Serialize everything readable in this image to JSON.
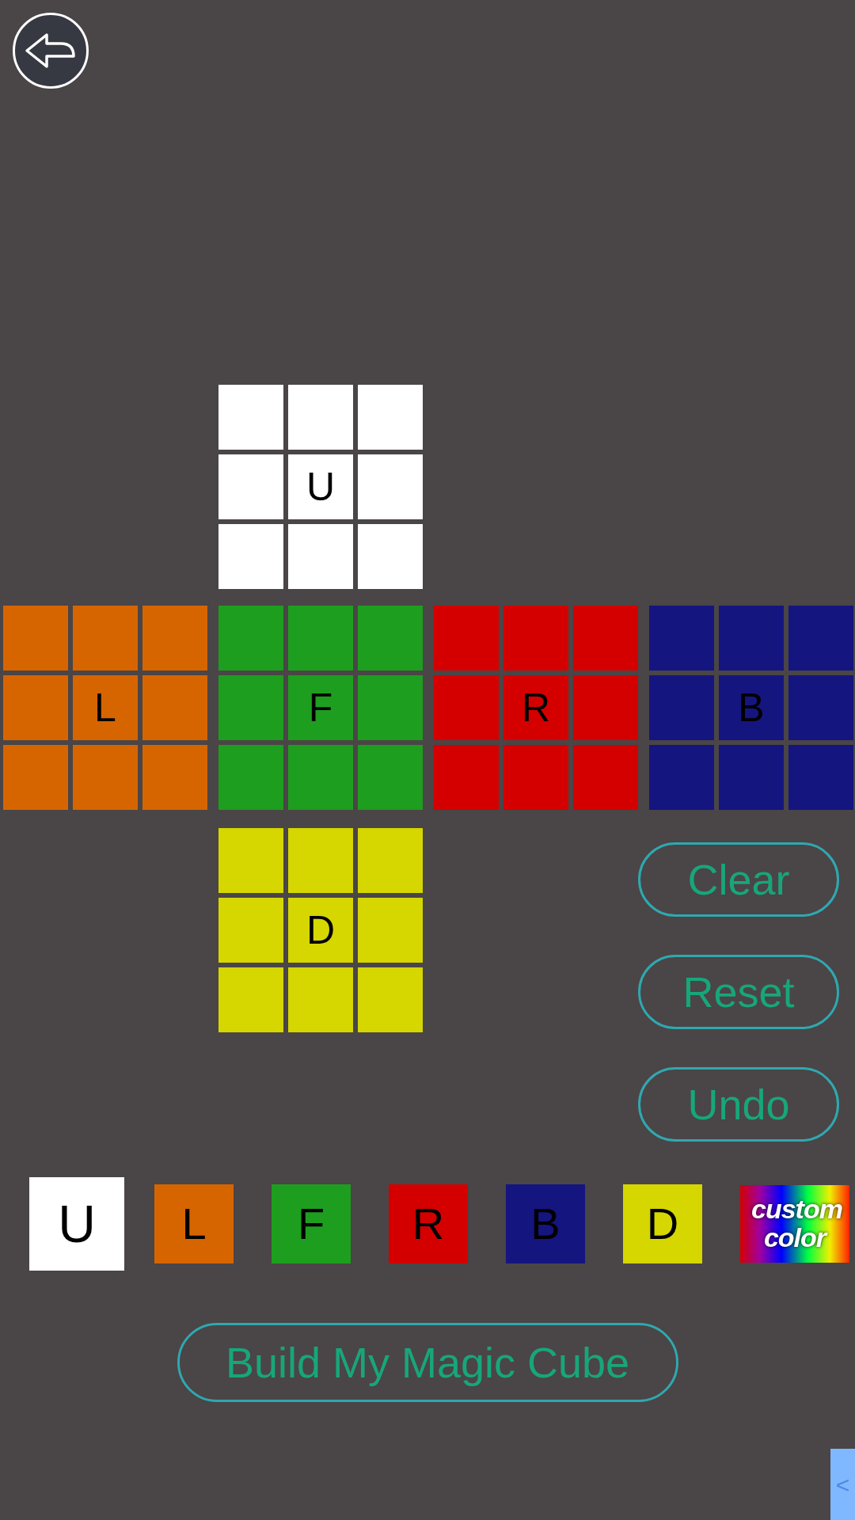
{
  "back_button": {
    "kind": "back"
  },
  "faces": [
    {
      "label": "U",
      "cells": [
        {
          "color": "#ffffff"
        },
        {
          "color": "#ffffff"
        },
        {
          "color": "#ffffff"
        },
        {
          "color": "#ffffff"
        },
        {
          "color": "#ffffff"
        },
        {
          "color": "#ffffff"
        },
        {
          "color": "#ffffff"
        },
        {
          "color": "#ffffff"
        },
        {
          "color": "#ffffff"
        }
      ]
    },
    {
      "label": "L",
      "cells": [
        {
          "color": "#d66500"
        },
        {
          "color": "#d66500"
        },
        {
          "color": "#d66500"
        },
        {
          "color": "#d66500"
        },
        {
          "color": "#d66500"
        },
        {
          "color": "#d66500"
        },
        {
          "color": "#d66500"
        },
        {
          "color": "#d66500"
        },
        {
          "color": "#d66500"
        }
      ]
    },
    {
      "label": "F",
      "cells": [
        {
          "color": "#1e9e1e"
        },
        {
          "color": "#1e9e1e"
        },
        {
          "color": "#1e9e1e"
        },
        {
          "color": "#1e9e1e"
        },
        {
          "color": "#1e9e1e"
        },
        {
          "color": "#1e9e1e"
        },
        {
          "color": "#1e9e1e"
        },
        {
          "color": "#1e9e1e"
        },
        {
          "color": "#1e9e1e"
        }
      ]
    },
    {
      "label": "R",
      "cells": [
        {
          "color": "#d40000"
        },
        {
          "color": "#d40000"
        },
        {
          "color": "#d40000"
        },
        {
          "color": "#d40000"
        },
        {
          "color": "#d40000"
        },
        {
          "color": "#d40000"
        },
        {
          "color": "#d40000"
        },
        {
          "color": "#d40000"
        },
        {
          "color": "#d40000"
        }
      ]
    },
    {
      "label": "B",
      "cells": [
        {
          "color": "#151580"
        },
        {
          "color": "#151580"
        },
        {
          "color": "#151580"
        },
        {
          "color": "#151580"
        },
        {
          "color": "#151580"
        },
        {
          "color": "#151580"
        },
        {
          "color": "#151580"
        },
        {
          "color": "#151580"
        },
        {
          "color": "#151580"
        }
      ]
    },
    {
      "label": "D",
      "cells": [
        {
          "color": "#d6d600"
        },
        {
          "color": "#d6d600"
        },
        {
          "color": "#d6d600"
        },
        {
          "color": "#d6d600"
        },
        {
          "color": "#d6d600"
        },
        {
          "color": "#d6d600"
        },
        {
          "color": "#d6d600"
        },
        {
          "color": "#d6d600"
        },
        {
          "color": "#d6d600"
        }
      ]
    }
  ],
  "actions": [
    "Clear",
    "Reset",
    "Undo"
  ],
  "palette": [
    {
      "kind": "swatch",
      "label": "U",
      "color": "#ffffff",
      "selected": true
    },
    {
      "kind": "swatch",
      "label": "L",
      "color": "#d66500",
      "selected": false
    },
    {
      "kind": "swatch",
      "label": "F",
      "color": "#1e9e1e",
      "selected": false
    },
    {
      "kind": "swatch",
      "label": "R",
      "color": "#d40000",
      "selected": false
    },
    {
      "kind": "swatch",
      "label": "B",
      "color": "#151580",
      "selected": false
    },
    {
      "kind": "swatch",
      "label": "D",
      "color": "#d6d600",
      "selected": false
    },
    {
      "kind": "custom",
      "label": "custom color",
      "selected": false
    }
  ],
  "build_button": "Build My Magic Cube",
  "side_tab": "<"
}
